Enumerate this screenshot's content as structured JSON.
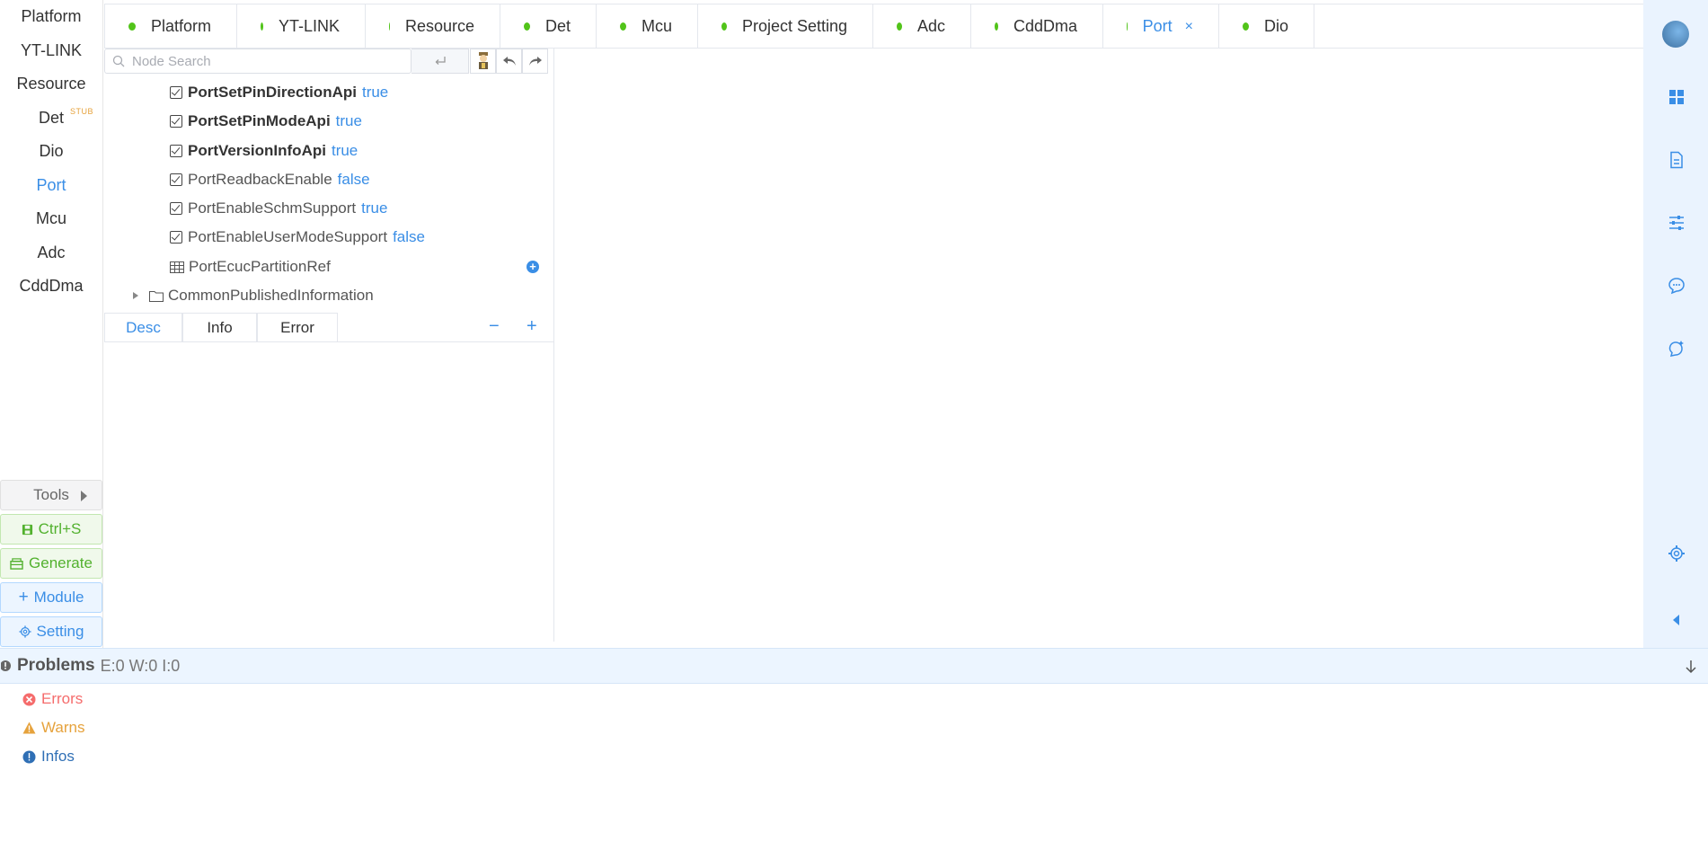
{
  "sidebar": {
    "items": [
      {
        "label": "Platform"
      },
      {
        "label": "YT-LINK"
      },
      {
        "label": "Resource"
      },
      {
        "label": "Det",
        "badge": "STUB"
      },
      {
        "label": "Dio"
      },
      {
        "label": "Port",
        "active": true
      },
      {
        "label": "Mcu"
      },
      {
        "label": "Adc"
      },
      {
        "label": "CddDma"
      }
    ],
    "buttons": {
      "tools": "Tools",
      "save": "Ctrl+S",
      "generate": "Generate",
      "module": "Module",
      "setting": "Setting"
    }
  },
  "tabs": [
    {
      "label": "Platform"
    },
    {
      "label": "YT-LINK"
    },
    {
      "label": "Resource"
    },
    {
      "label": "Det"
    },
    {
      "label": "Mcu"
    },
    {
      "label": "Project Setting"
    },
    {
      "label": "Adc"
    },
    {
      "label": "CddDma"
    },
    {
      "label": "Port",
      "active": true,
      "close": "×"
    },
    {
      "label": "Dio"
    }
  ],
  "search": {
    "placeholder": "Node Search"
  },
  "tree": [
    {
      "label": "PortSetPinDirectionApi",
      "value": "true",
      "bold": true
    },
    {
      "label": "PortSetPinModeApi",
      "value": "true",
      "bold": true
    },
    {
      "label": "PortVersionInfoApi",
      "value": "true",
      "bold": true
    },
    {
      "label": "PortReadbackEnable",
      "value": "false"
    },
    {
      "label": "PortEnableSchmSupport",
      "value": "true"
    },
    {
      "label": "PortEnableUserModeSupport",
      "value": "false"
    },
    {
      "label": "PortEcucPartitionRef",
      "value": ""
    },
    {
      "label": "CommonPublishedInformation",
      "value": ""
    }
  ],
  "desc_tabs": [
    "Desc",
    "Info",
    "Error"
  ],
  "desc_controls": {
    "minus": "−",
    "plus": "+"
  },
  "problems": {
    "title": "Problems",
    "counts": "E:0 W:0 I:0",
    "errors": "Errors",
    "warns": "Warns",
    "infos": "Infos"
  },
  "colors": {
    "accent": "#3a8ee6",
    "status_ok": "#52c41a",
    "error": "#f56c6c",
    "warn": "#e6a23c",
    "info": "#3a8ee6"
  }
}
